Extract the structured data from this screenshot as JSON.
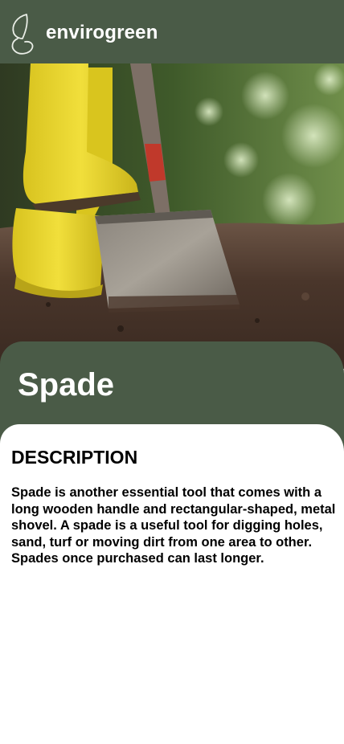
{
  "header": {
    "brand_name": "envirogreen",
    "logo_icon": "leaf-g-logo-icon",
    "background_color": "#4a5b47"
  },
  "hero_image": {
    "subject": "yellow-rubber-boot-pushing-spade-into-soil"
  },
  "product": {
    "title": "Spade",
    "panel_color": "#4a5b47"
  },
  "description": {
    "heading": "DESCRIPTION",
    "body": "Spade is another essential tool that comes with a long wooden handle and rectangular-shaped, metal shovel. A spade is a useful tool for digging holes, sand, turf or moving dirt from one area to other. Spades once purchased can last longer."
  }
}
